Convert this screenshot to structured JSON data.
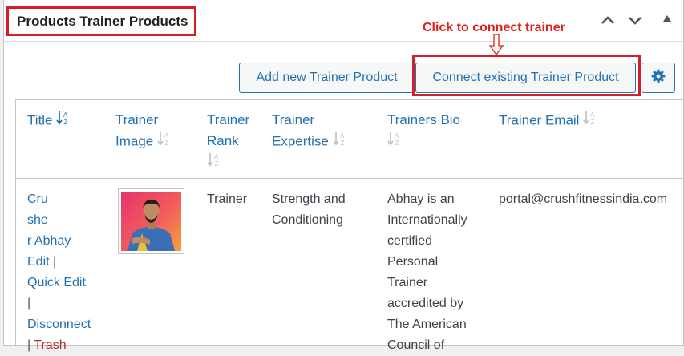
{
  "metabox": {
    "title": "Products Trainer Products",
    "controls": [
      "chevron-up-icon",
      "chevron-down-icon",
      "triangle-up-icon"
    ]
  },
  "annotation": {
    "text": "Click to connect trainer",
    "color": "#e0211b"
  },
  "toolbar": {
    "add_label": "Add new Trainer Product",
    "connect_label": "Connect existing Trainer Product",
    "settings_icon": "gear-icon"
  },
  "table": {
    "headers": {
      "title": "Title",
      "image": [
        "Trainer",
        "Image"
      ],
      "rank": [
        "Trainer",
        "Rank"
      ],
      "expertise": [
        "Trainer",
        "Expertise"
      ],
      "bio": "Trainers Bio",
      "email": "Trainer Email"
    },
    "rows": [
      {
        "title_lines": [
          "Cru",
          "she",
          "r Abhay"
        ],
        "actions": {
          "edit": "Edit",
          "quick_edit": "Quick Edit",
          "disconnect": "Disconnect",
          "trash": "Trash",
          "separator": "|"
        },
        "image_alt": "trainer-photo",
        "rank": "Trainer",
        "expertise_lines": [
          "Strength and",
          "Conditioning"
        ],
        "bio_lines": [
          "Abhay is an",
          "Internationally",
          "certified",
          "Personal",
          "Trainer",
          "accredited by",
          "The American",
          "Council of"
        ],
        "email": "portal@crushfitnessindia.com"
      }
    ]
  },
  "colors": {
    "link": "#2271b1",
    "highlight": "#d51f26",
    "trash": "#b32d2e"
  }
}
